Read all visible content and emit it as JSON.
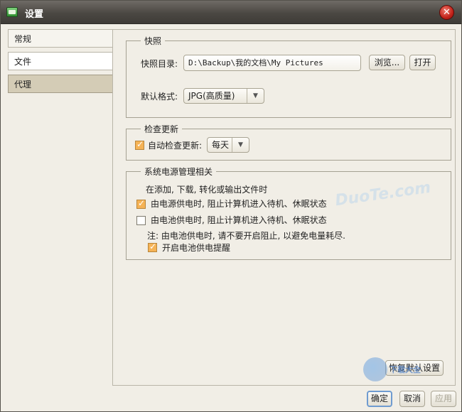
{
  "window": {
    "title": "设置"
  },
  "nav": {
    "items": [
      "常规",
      "文件",
      "代理"
    ]
  },
  "snapshot": {
    "legend": "快照",
    "dir_label": "快照目录:",
    "dir_value": "D:\\Backup\\我的文档\\My Pictures",
    "browse_label": "浏览...",
    "open_label": "打开",
    "format_label": "默认格式:",
    "format_value": "JPG(高质量)"
  },
  "update": {
    "legend": "检查更新",
    "auto_label": "自动检查更新:",
    "auto_checked": true,
    "frequency_value": "每天"
  },
  "power": {
    "legend": "系统电源管理相关",
    "intro": "在添加, 下载, 转化或输出文件时",
    "ac_label": "由电源供电时, 阻止计算机进入待机、休眠状态",
    "ac_checked": true,
    "battery_label": "由电池供电时, 阻止计算机进入待机、休眠状态",
    "battery_checked": false,
    "note": "注: 由电池供电时, 请不要开启阻止, 以避免电量耗尽.",
    "reminder_label": "开启电池供电提醒",
    "reminder_checked": true
  },
  "restore_label": "恢复默认设置",
  "footer": {
    "ok_label": "确定",
    "cancel_label": "取消",
    "apply_label": "应用"
  },
  "watermark": {
    "text": "DuoTe.com",
    "site_text": "下载大全"
  }
}
